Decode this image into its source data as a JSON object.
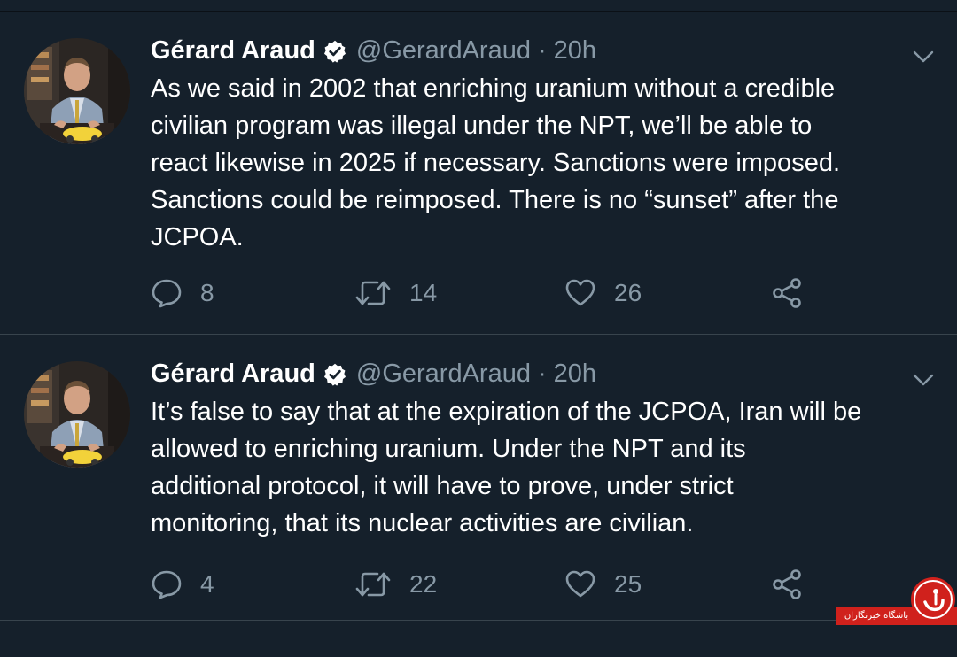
{
  "tweets": [
    {
      "author_name": "Gérard Araud",
      "author_handle": "@GerardAraud",
      "separator": "·",
      "time": "20h",
      "text": "As we said in 2002 that enriching uranium without a credible\ncivilian program was illegal under the NPT, we’ll be able to\nreact likewise in 2025 if necessary. Sanctions were imposed.\nSanctions could be reimposed. There is no “sunset” after the\nJCPOA.",
      "replies": "8",
      "retweets": "14",
      "likes": "26"
    },
    {
      "author_name": "Gérard Araud",
      "author_handle": "@GerardAraud",
      "separator": "·",
      "time": "20h",
      "text": "It’s false to say that at the expiration of the JCPOA, Iran will be\nallowed to enriching uranium. Under the NPT and its\nadditional protocol, it will have to prove, under strict\nmonitoring, that its nuclear activities are civilian.",
      "replies": "4",
      "retweets": "22",
      "likes": "25"
    }
  ],
  "icons": {
    "reply": "reply-icon",
    "retweet": "retweet-icon",
    "like": "heart-icon",
    "share": "share-icon",
    "verified": "verified-badge-icon",
    "menu": "chevron-down-icon"
  },
  "colors": {
    "background": "#15202b",
    "primary_text": "#ffffff",
    "secondary_text": "#8899a6",
    "divider": "#38444d",
    "watermark": "#d0211c"
  },
  "watermark": {
    "label": "باشگاه خبرنگاران"
  }
}
